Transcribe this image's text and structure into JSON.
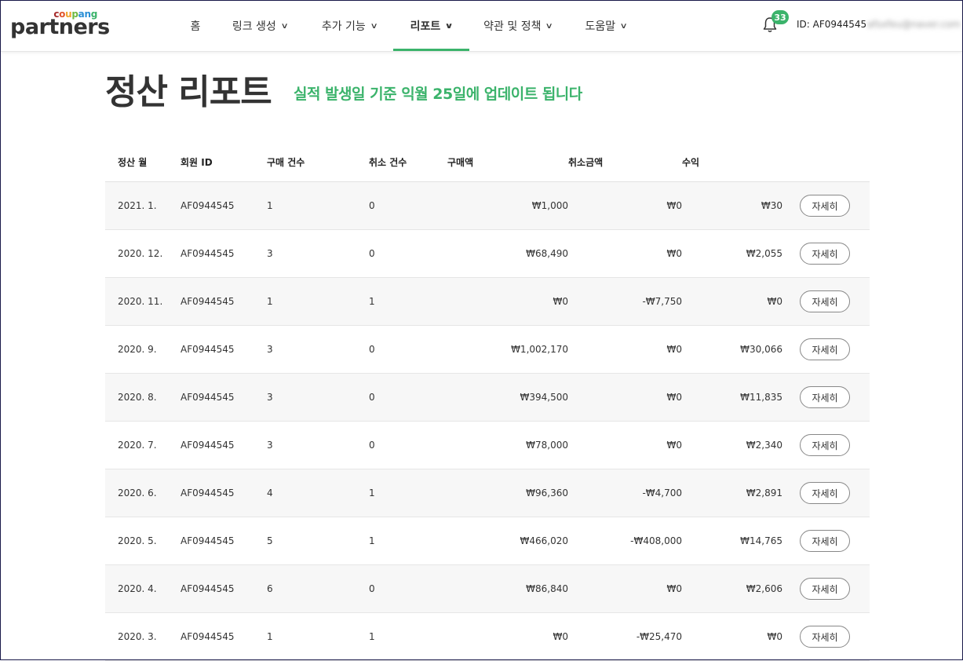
{
  "brand": {
    "top": "coupang",
    "top_colors": [
      "#a52a2a",
      "#e0542b",
      "#f0a52b",
      "#6eb940",
      "#2a8fd6",
      "#2a8fd6",
      "#3bb36b"
    ],
    "name": "partners"
  },
  "nav": {
    "items": [
      {
        "label": "홈",
        "dropdown": false,
        "active": false
      },
      {
        "label": "링크 생성",
        "dropdown": true,
        "active": false
      },
      {
        "label": "추가 기능",
        "dropdown": true,
        "active": false
      },
      {
        "label": "리포트",
        "dropdown": true,
        "active": true
      },
      {
        "label": "약관 및 정책",
        "dropdown": true,
        "active": false
      },
      {
        "label": "도움말",
        "dropdown": true,
        "active": false
      }
    ],
    "accent_color": "#3bb36b"
  },
  "account": {
    "notification_count": "33",
    "user_id": "ID: AF0944545",
    "email": "afsxfeu@naver.com"
  },
  "page": {
    "title": "정산 리포트",
    "subtitle": "실적 발생일 기준 익월 25일에 업데이트 됩니다"
  },
  "table": {
    "headers": [
      "정산 월",
      "회원 ID",
      "구매 건수",
      "취소 건수",
      "구매액",
      "취소금액",
      "수익"
    ],
    "detail_label": "자세히",
    "rows": [
      {
        "month": "2021. 1.",
        "member_id": "AF0944545",
        "purchases": "1",
        "cancels": "0",
        "purchase_amount": "₩1,000",
        "cancel_amount": "₩0",
        "revenue": "₩30"
      },
      {
        "month": "2020. 12.",
        "member_id": "AF0944545",
        "purchases": "3",
        "cancels": "0",
        "purchase_amount": "₩68,490",
        "cancel_amount": "₩0",
        "revenue": "₩2,055"
      },
      {
        "month": "2020. 11.",
        "member_id": "AF0944545",
        "purchases": "1",
        "cancels": "1",
        "purchase_amount": "₩0",
        "cancel_amount": "-₩7,750",
        "revenue": "₩0"
      },
      {
        "month": "2020. 9.",
        "member_id": "AF0944545",
        "purchases": "3",
        "cancels": "0",
        "purchase_amount": "₩1,002,170",
        "cancel_amount": "₩0",
        "revenue": "₩30,066"
      },
      {
        "month": "2020. 8.",
        "member_id": "AF0944545",
        "purchases": "3",
        "cancels": "0",
        "purchase_amount": "₩394,500",
        "cancel_amount": "₩0",
        "revenue": "₩11,835"
      },
      {
        "month": "2020. 7.",
        "member_id": "AF0944545",
        "purchases": "3",
        "cancels": "0",
        "purchase_amount": "₩78,000",
        "cancel_amount": "₩0",
        "revenue": "₩2,340"
      },
      {
        "month": "2020. 6.",
        "member_id": "AF0944545",
        "purchases": "4",
        "cancels": "1",
        "purchase_amount": "₩96,360",
        "cancel_amount": "-₩4,700",
        "revenue": "₩2,891"
      },
      {
        "month": "2020. 5.",
        "member_id": "AF0944545",
        "purchases": "5",
        "cancels": "1",
        "purchase_amount": "₩466,020",
        "cancel_amount": "-₩408,000",
        "revenue": "₩14,765"
      },
      {
        "month": "2020. 4.",
        "member_id": "AF0944545",
        "purchases": "6",
        "cancels": "0",
        "purchase_amount": "₩86,840",
        "cancel_amount": "₩0",
        "revenue": "₩2,606"
      },
      {
        "month": "2020. 3.",
        "member_id": "AF0944545",
        "purchases": "1",
        "cancels": "1",
        "purchase_amount": "₩0",
        "cancel_amount": "-₩25,470",
        "revenue": "₩0"
      }
    ]
  }
}
